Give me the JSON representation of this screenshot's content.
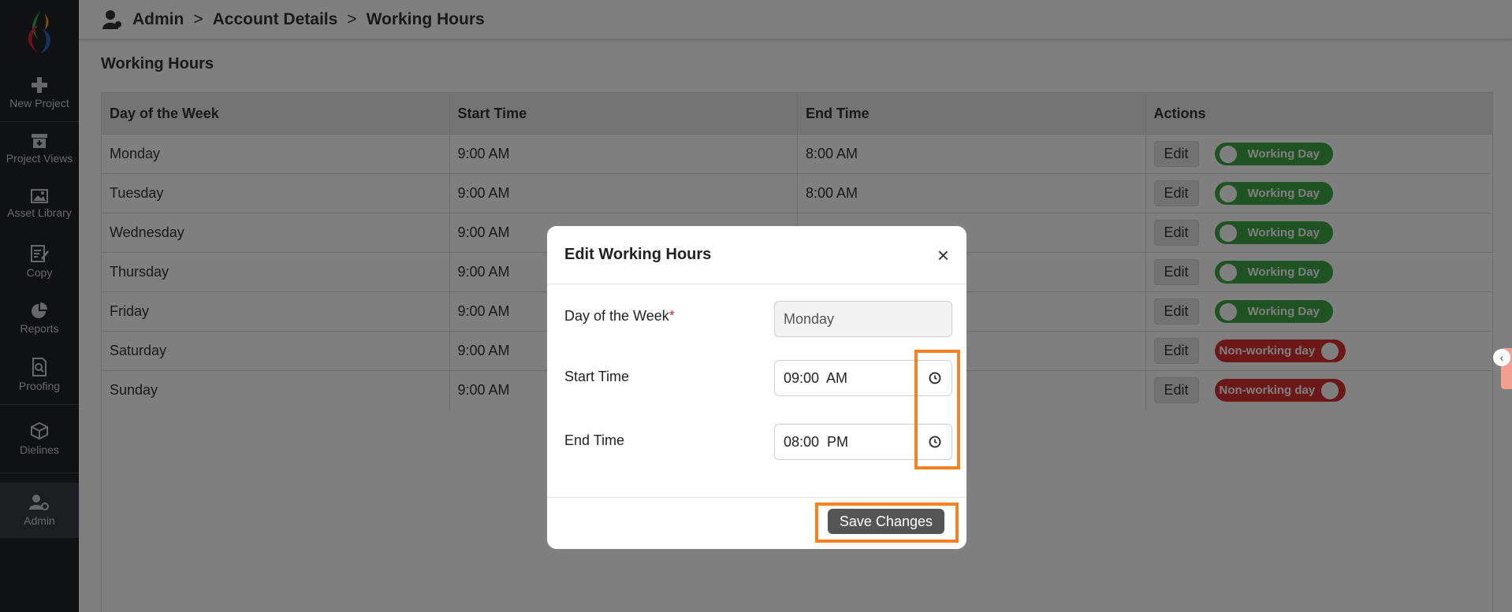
{
  "sidebar": {
    "items": [
      {
        "label": "New Project",
        "icon": "plus-icon"
      },
      {
        "label": "Project Views",
        "icon": "archive-icon"
      },
      {
        "label": "Asset Library",
        "icon": "image-icon"
      },
      {
        "label": "Copy",
        "icon": "edit-document-icon"
      },
      {
        "label": "Reports",
        "icon": "pie-chart-icon"
      },
      {
        "label": "Proofing",
        "icon": "search-document-icon"
      },
      {
        "label": "Dielines",
        "icon": "box-icon"
      },
      {
        "label": "Admin",
        "icon": "user-gear-icon"
      }
    ]
  },
  "breadcrumb": {
    "items": [
      "Admin",
      "Account Details",
      "Working Hours"
    ],
    "separator": ">"
  },
  "page": {
    "title": "Working Hours"
  },
  "table": {
    "headers": [
      "Day of the Week",
      "Start Time",
      "End Time",
      "Actions"
    ],
    "edit_label": "Edit",
    "rows": [
      {
        "day": "Monday",
        "start": "9:00 AM",
        "end": "8:00 AM",
        "status": "Working Day",
        "working": true
      },
      {
        "day": "Tuesday",
        "start": "9:00 AM",
        "end": "8:00 AM",
        "status": "Working Day",
        "working": true
      },
      {
        "day": "Wednesday",
        "start": "9:00 AM",
        "end": "",
        "status": "Working Day",
        "working": true
      },
      {
        "day": "Thursday",
        "start": "9:00 AM",
        "end": "",
        "status": "Working Day",
        "working": true
      },
      {
        "day": "Friday",
        "start": "9:00 AM",
        "end": "",
        "status": "Working Day",
        "working": true
      },
      {
        "day": "Saturday",
        "start": "9:00 AM",
        "end": "",
        "status": "Non-working day",
        "working": false
      },
      {
        "day": "Sunday",
        "start": "9:00 AM",
        "end": "",
        "status": "Non-working day",
        "working": false
      }
    ]
  },
  "modal": {
    "title": "Edit Working Hours",
    "close_symbol": "×",
    "day_label": "Day of the Week",
    "required_mark": "*",
    "day_value": "Monday",
    "start_label": "Start Time",
    "start_value": "09:00  AM",
    "end_label": "End Time",
    "end_value": "08:00  PM",
    "save_label": "Save Changes"
  },
  "colors": {
    "working": "#3ea746",
    "non_working": "#d83030",
    "highlight": "#f58220"
  }
}
